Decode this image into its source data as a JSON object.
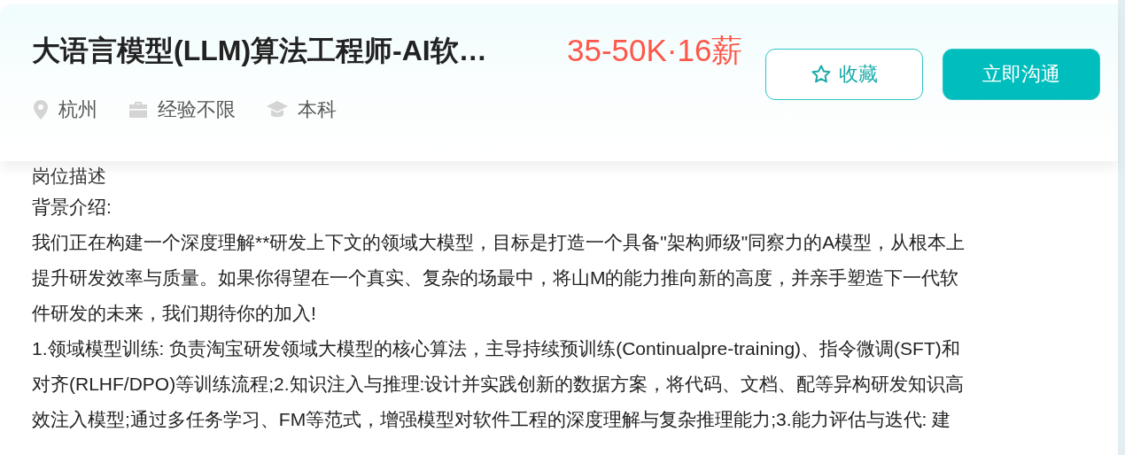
{
  "header": {
    "title": "大语言模型(LLM)算法工程师-AI软…",
    "salary": "35-50K·16薪",
    "meta": [
      {
        "kind": "location",
        "text": "杭州"
      },
      {
        "kind": "experience",
        "text": "经验不限"
      },
      {
        "kind": "education",
        "text": "本科"
      }
    ],
    "buttons": [
      {
        "kind": "favorite",
        "label": "收藏"
      },
      {
        "kind": "chat",
        "label": "立即沟通"
      }
    ]
  },
  "description": {
    "heading": "岗位描述",
    "paragraphs": [
      [
        "背景介绍:"
      ],
      [
        "我们正在构建一个深度理解**研发上下文的领域大模型，目标是打造一个具备\"架构师级\"同察力的A模型，从根本上",
        "提升研发效率与质量。如果你得望在一个真实、复杂的场最中，将山M的能力推向新的高度，并亲手塑造下一代软",
        "件研发的未来，我们期待你的加入!"
      ],
      [
        "1.领域模型训练: 负责淘宝研发领域大模型的核心算法，主导持续预训练(Continualpre-training)、指令微调(SFT)和",
        "对齐(RLHF/DPO)等训练流程;2.知识注入与推理:设计并实践创新的数据方案，将代码、文档、配等异构研发知识高",
        "效注入模型;通过多任务学习、FM等范式，增强模型对软件工程的深度理解与复杂推理能力;3.能力评估与迭代: 建"
      ]
    ]
  }
}
